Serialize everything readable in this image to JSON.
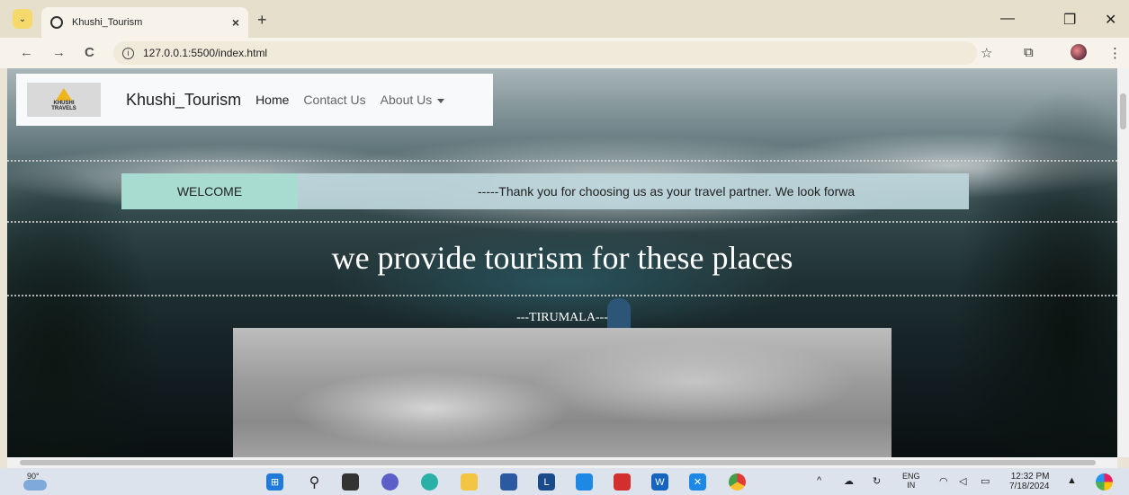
{
  "browser": {
    "tab_title": "Khushi_Tourism",
    "tab_close": "×",
    "new_tab": "+",
    "url": "127.0.0.1:5500/index.html",
    "back": "←",
    "forward": "→",
    "reload": "C",
    "bookmark": "☆",
    "window_minimize": "—",
    "window_restore": "❐",
    "window_close": "✕",
    "menu": "⋮"
  },
  "navbar": {
    "logo_text": "KHUSHI TRAVELS",
    "brand": "Khushi_Tourism",
    "links": [
      {
        "label": "Home"
      },
      {
        "label": "Contact Us"
      },
      {
        "label": "About Us"
      }
    ]
  },
  "welcome": {
    "label": "WELCOME",
    "marquee": "-----Thank you for choosing us as your travel partner. We look forwa"
  },
  "main": {
    "headline": "we provide tourism for these places",
    "place_title": "---TIRUMALA---"
  },
  "taskbar": {
    "weather_temp": "90°",
    "lang_line1": "ENG",
    "lang_line2": "IN",
    "time": "12:32 PM",
    "date": "7/18/2024"
  },
  "colors": {
    "welcome_label_bg": "#a8dcd1",
    "welcome_bar_bg": "#bed7dc",
    "navbar_bg": "#f8f9fa",
    "tab_strip_bg": "#e6dfcb"
  }
}
